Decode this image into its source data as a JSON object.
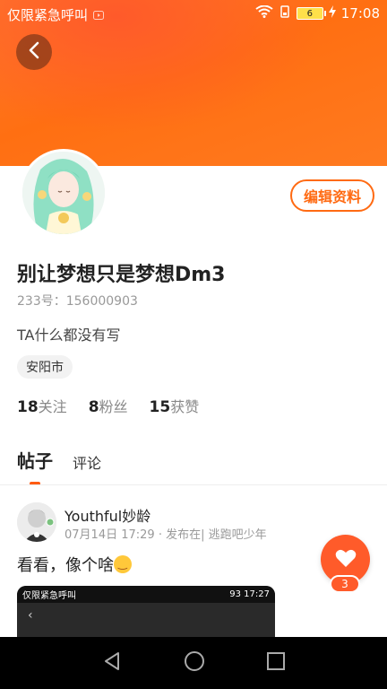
{
  "status_bar": {
    "carrier": "仅限紧急呼叫",
    "battery": "6",
    "time": "17:08"
  },
  "profile": {
    "edit_button": "编辑资料",
    "username": "别让梦想只是梦想Dm3",
    "id_line": "233号：156000903",
    "bio": "TA什么都没有写",
    "location_tag": "安阳市",
    "stats": {
      "following_count": "18",
      "following_label": "关注",
      "followers_count": "8",
      "followers_label": "粉丝",
      "likes_count": "15",
      "likes_label": "获赞"
    }
  },
  "tabs": {
    "posts": "帖子",
    "comments": "评论"
  },
  "post": {
    "author": "Youthful妙龄",
    "meta": "07月14日 17:29 · 发布在| 逃跑吧少年",
    "text": "看看，像个啥",
    "image_status": {
      "carrier": "仅限紧急呼叫",
      "battery": "93",
      "time": "17:27"
    },
    "like_count": "3"
  },
  "colors": {
    "accent": "#ff6a12",
    "header": "#ff7518",
    "fab": "#ff5b2a"
  }
}
